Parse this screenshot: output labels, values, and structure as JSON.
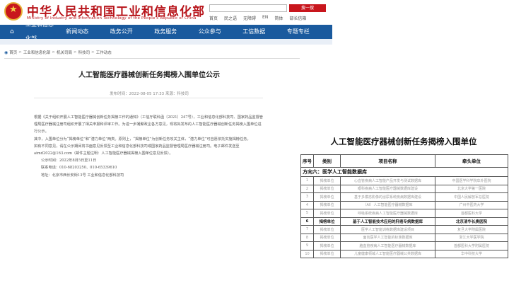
{
  "header": {
    "site_title": "中华人民共和国工业和信息化部",
    "site_subtitle": "Ministry of Industry and Information Technology of the People's Republic of China",
    "search_button": "搜一搜",
    "top_links": [
      "首页",
      "民之语",
      "无障碍",
      "EN",
      "简体",
      "部长信箱"
    ]
  },
  "nav": {
    "items": [
      "工业和信息化部",
      "新闻动态",
      "政务公开",
      "政务服务",
      "公众参与",
      "工信数据",
      "专题专栏"
    ]
  },
  "breadcrumb": [
    "首页",
    "工业和信息化部",
    "机关司局",
    "科技司",
    "工作动态"
  ],
  "article": {
    "title": "人工智能医疗器械创新任务揭榜入围单位公示",
    "meta": "发布时间：2022-08-05 17:33    来源：科技司",
    "paragraphs": [
      "根据《关于组织开展人工智能医疗器械创新任务揭榜工作的通知》（工信厅联科函〔2021〕247号），工业和信息化部科技司、国家药品监督管理局医疗器械注册司组织开展了相关申报和评审工作。为进一步凝聚政企各方意见，现将拟发布的人工智能医疗器械创新任务揭榜入围单位进行公示。",
      "其中，入围单位分为“揭榜单位”和“潜力单位”两类。原则上，“揭榜单位”为创新任务攻关主体，“潜力单位”可自愿依托实施揭榜任务。",
      "如有不同意见，请在公示期间将书面意见反馈至工业和信息化部科技司或国家药品监督管理局医疗器械注册司。电子邮件发送至aimd2022@163.com（邮件主题注明：人工智能医疗器械揭榜入围单位意见反馈）。"
    ],
    "info_lines": [
      "公示时间：2022年8月5日至11日",
      "联系电话：010-68203250、010-65339610",
      "地址：北京市西长安街13号 工业和信息化部科技司"
    ]
  },
  "document": {
    "title": "人工智能医疗器械创新任务揭榜入围单位",
    "columns": [
      "序号",
      "类别",
      "项目名称",
      "牵头单位"
    ],
    "section": "方向六：医学人工智能数据库",
    "rows": [
      [
        "1",
        "揭榜单位",
        "心血管疾病人工智能产品开发与测试数据库",
        "中国医学科学院阜外医院"
      ],
      [
        "2",
        "揭榜单位",
        "眼科疾病人工智能医疗器械数据库建设",
        "北京大学第一医院"
      ],
      [
        "3",
        "揭榜单位",
        "基于多模态影像的泌尿系统疾病数据库建设",
        "中国人民解放军总医院"
      ],
      [
        "4",
        "揭榜单位",
        "（AI）人工智能医疗器械数据库",
        "广州中医药大学"
      ],
      [
        "5",
        "揭榜单位",
        "呼吸系统疾病人工智能医疗器械数据库",
        "首都医科大学"
      ],
      [
        "6",
        "揭榜单位",
        "基于人工智能技术应用的肝癌专病数据库",
        "北京清华长庚医院"
      ],
      [
        "7",
        "揭榜单位",
        "医学人工智能训练数据库建设项目",
        "复旦大学附属医院"
      ],
      [
        "8",
        "揭榜单位",
        "面向医学人工智能的标准数据库",
        "浙江大学医学院"
      ],
      [
        "9",
        "揭榜单位",
        "脑血管疾病人工智能医疗器械数据库",
        "首都医科大学附属医院"
      ],
      [
        "10",
        "揭榜单位",
        "儿童健康领域人工智能医疗器械公共数据库",
        "华中科技大学"
      ]
    ],
    "highlight_row": 5
  }
}
